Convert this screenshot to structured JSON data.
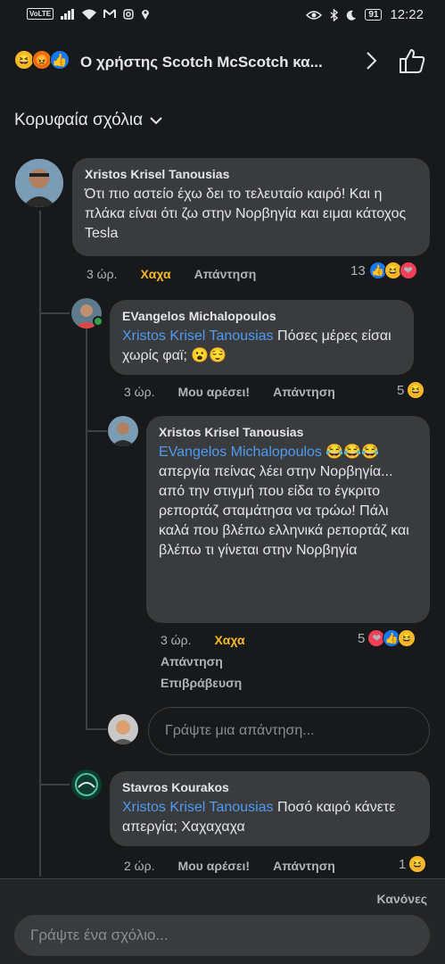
{
  "status": {
    "volte": "VoLTE",
    "battery": "91",
    "time": "12:22"
  },
  "header": {
    "title": "Ο χρήστης Scotch McScotch κα...",
    "reactions": [
      "laughing",
      "angry",
      "like"
    ]
  },
  "sort": {
    "label": "Κορυφαία σχόλια"
  },
  "comments": [
    {
      "author": "Xristos Krisel Tanousias",
      "text": "Ότι πιο αστείο έχω δει το τελευταίο καιρό! Και η πλάκα είναι ότι ζω στην Νορβηγία και ειμαι κάτοχος Tesla",
      "time": "3 ώρ.",
      "reaction_label": "Χαχα",
      "reply_label": "Απάντηση",
      "count": "13"
    },
    {
      "author": "EVangelos Michalopoulos",
      "mention": "Xristos Krisel Tanousias",
      "text": " Πόσες μέρες είσαι χωρίς φαϊ; 😮😌",
      "time": "3 ώρ.",
      "like_label": "Μου αρέσει!",
      "reply_label": "Απάντηση",
      "count": "5"
    },
    {
      "author": "Xristos Krisel Tanousias",
      "mention": "EVangelos Michalopoulos",
      "text": " 😂😂😂 απεργία πείνας λέει στην Νορβηγία... από την στιγμή που είδα το έγκριτο ρεπορτάζ σταμάτησα να τρώω!  Πάλι καλά που βλέπω ελληνικά ρεπορτάζ και βλέπω τι γίνεται στην Νορβηγία",
      "time": "3 ώρ.",
      "reaction_label": "Χαχα",
      "reply_label": "Απάντηση",
      "award_label": "Επιβράβευση",
      "count": "5"
    },
    {
      "author": "Stavros Kourakos",
      "mention": "Xristos Krisel Tanousias",
      "text": " Ποσό καιρό κάνετε απεργία; Χαχαχαχα",
      "time": "2 ώρ.",
      "like_label": "Μου αρέσει!",
      "reply_label": "Απάντηση",
      "count": "1"
    }
  ],
  "reply_input": {
    "placeholder": "Γράψτε μια απάντηση..."
  },
  "footer": {
    "rules_label": "Κανόνες",
    "comment_placeholder": "Γράψτε ένα σχόλιο..."
  },
  "colors": {
    "background": "#18191a",
    "bubble": "#3a3b3c",
    "mention": "#4e9bf5",
    "haha": "#f7b928"
  }
}
